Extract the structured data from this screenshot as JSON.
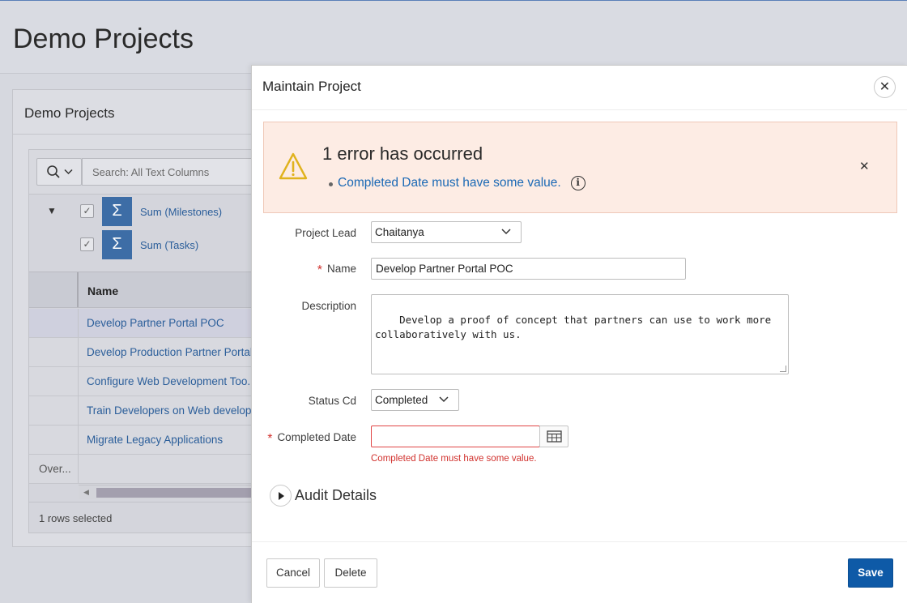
{
  "page": {
    "title": "Demo Projects",
    "region_title": "Demo Projects"
  },
  "grid": {
    "search_placeholder": "Search: All Text Columns",
    "aggregates": [
      {
        "label": "Sum (Milestones)",
        "checked": true
      },
      {
        "label": "Sum (Tasks)",
        "checked": true
      }
    ],
    "column_header": "Name",
    "rows": [
      "Develop Partner Portal POC",
      "Develop Production Partner Portal",
      "Configure Web Development Too...",
      "Train Developers on Web develop...",
      "Migrate Legacy Applications"
    ],
    "overall_label": "Over...",
    "footer_status": "1 rows selected"
  },
  "dialog": {
    "title": "Maintain Project",
    "alert": {
      "title": "1 error has occurred",
      "message": "Completed Date must have some value."
    },
    "fields": {
      "project_lead": {
        "label": "Project Lead",
        "value": "Chaitanya"
      },
      "name": {
        "label": "Name",
        "value": "Develop Partner Portal POC"
      },
      "description": {
        "label": "Description",
        "value": "Develop a proof of concept that partners can use to work more\ncollaboratively with us."
      },
      "status_cd": {
        "label": "Status Cd",
        "value": "Completed"
      },
      "completed_date": {
        "label": "Completed Date",
        "value": "",
        "error": "Completed Date must have some value."
      }
    },
    "audit_title": "Audit Details",
    "buttons": {
      "cancel": "Cancel",
      "delete": "Delete",
      "save": "Save"
    }
  },
  "colors": {
    "primary_button": "#0e5aa7",
    "link": "#1b69b5",
    "error": "#d1312d",
    "alert_background": "#fdece4"
  },
  "icons": [
    "search-icon",
    "chevron-down-icon",
    "caret-down-icon",
    "checkbox-icon",
    "sigma-icon",
    "close-icon",
    "warning-icon",
    "info-icon",
    "calendar-icon",
    "expand-icon"
  ]
}
